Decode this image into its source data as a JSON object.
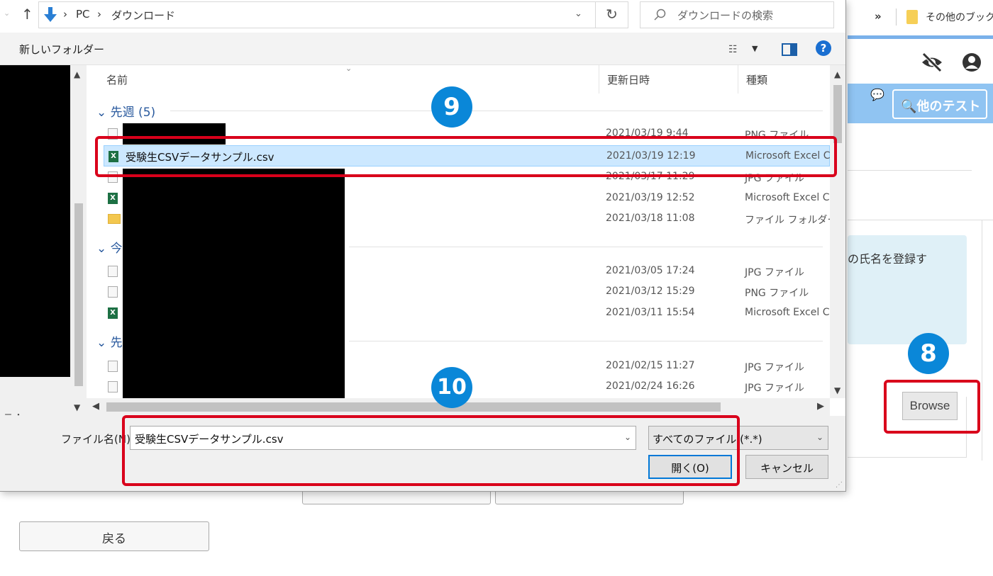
{
  "browser": {
    "more_chevrons": "»",
    "bookmark_folder_label": "その他のブック",
    "search_other_tests": "他のテスト",
    "info_text": "の氏名を登録す",
    "browse_button": "Browse",
    "back_button": "戻る",
    "hidden_button_1": "",
    "hidden_button_2": ""
  },
  "dialog": {
    "breadcrumb": [
      "PC",
      "ダウンロード"
    ],
    "breadcrumb_separator": "›",
    "search_placeholder": "ダウンロードの検索",
    "new_folder": "新しいフォルダー",
    "columns": {
      "name": "名前",
      "date": "更新日時",
      "type": "種類"
    },
    "groups": [
      {
        "label": "先週 (5)"
      },
      {
        "label": "今"
      },
      {
        "label": "先"
      }
    ],
    "rows": [
      {
        "name": "",
        "date": "2021/03/19 9:44",
        "type": "PNG ファイル",
        "icon": "file"
      },
      {
        "name": "受験生CSVデータサンプル.csv",
        "date": "2021/03/19 12:19",
        "type": "Microsoft Excel C",
        "icon": "xls",
        "selected": true
      },
      {
        "name": "",
        "date": "2021/03/17 11:29",
        "type": "JPG ファイル",
        "icon": "file"
      },
      {
        "name": "",
        "date": "2021/03/19 12:52",
        "type": "Microsoft Excel C",
        "icon": "xls"
      },
      {
        "name": "",
        "date": "2021/03/18 11:08",
        "type": "ファイル フォルダー",
        "icon": "folder"
      },
      {
        "name": "",
        "date": "2021/03/05 17:24",
        "type": "JPG ファイル",
        "icon": "file"
      },
      {
        "name": "",
        "date": "2021/03/12 15:29",
        "type": "PNG ファイル",
        "icon": "file"
      },
      {
        "name": "",
        "date": "2021/03/11 15:54",
        "type": "Microsoft Excel C",
        "icon": "xls"
      },
      {
        "name": "",
        "date": "2021/02/15 11:27",
        "type": "JPG ファイル",
        "icon": "file"
      },
      {
        "name": "",
        "date": "2021/02/24 16:26",
        "type": "JPG ファイル",
        "icon": "file"
      }
    ],
    "filename_label": "ファイル名(N):",
    "filename_value": "受験生CSVデータサンプル.csv",
    "filetype_value": "すべてのファイル (*.*)",
    "open_button": "開く(O)",
    "cancel_button": "キャンセル",
    "help": "?",
    "nav_fragment": "ー ・"
  },
  "annotations": {
    "step8": "8",
    "step9": "9",
    "step10": "10"
  },
  "colors": {
    "highlight": "#d9001b",
    "badge": "#0a87d8",
    "selection": "#cce8ff",
    "accent": "#0078d7"
  }
}
